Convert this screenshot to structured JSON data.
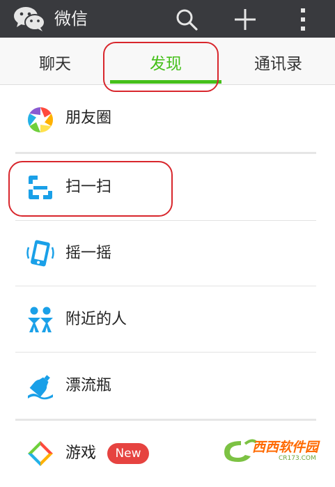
{
  "header": {
    "title": "微信"
  },
  "tabs": [
    {
      "label": "聊天"
    },
    {
      "label": "发现"
    },
    {
      "label": "通讯录"
    }
  ],
  "items": [
    {
      "label": "朋友圈",
      "icon": "moments-icon"
    },
    {
      "label": "扫一扫",
      "icon": "scan-icon"
    },
    {
      "label": "摇一摇",
      "icon": "shake-icon"
    },
    {
      "label": "附近的人",
      "icon": "people-nearby-icon"
    },
    {
      "label": "漂流瓶",
      "icon": "drift-bottle-icon"
    },
    {
      "label": "游戏",
      "icon": "games-icon",
      "badge": "New"
    }
  ],
  "watermark": {
    "text": "西西软件园",
    "sub": "CR173.COM"
  },
  "colors": {
    "header_bg": "#393a3e",
    "accent_green": "#45c01a",
    "badge_red": "#e64340",
    "annotation_red": "#d8262c",
    "icon_blue": "#1aa0e8"
  }
}
